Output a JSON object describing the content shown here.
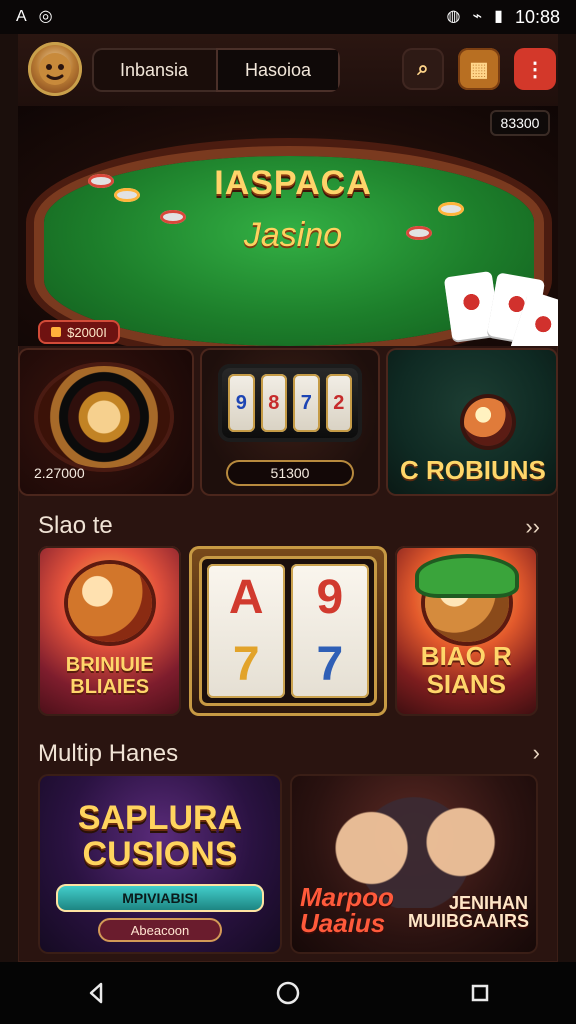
{
  "status_bar": {
    "left_icons": [
      "A",
      "◎"
    ],
    "time": "10:88"
  },
  "header": {
    "tabs": [
      {
        "label": "Inbansia",
        "active": false
      },
      {
        "label": "Hasoioa",
        "active": true
      }
    ],
    "buttons": {
      "search_icon": "search-icon",
      "grid_icon": "grid-icon",
      "menu_icon": "more-vert-icon"
    }
  },
  "hero": {
    "title": "IASPACA",
    "subtitle": "Jasino",
    "top_badge": "83300",
    "left_chip_value": "$2000I"
  },
  "featured": [
    {
      "id": "roulette",
      "amount": "2.27000"
    },
    {
      "id": "slots",
      "amount": "51300"
    },
    {
      "id": "poker",
      "title": "C ROBIUNS"
    }
  ],
  "sections": {
    "slots": {
      "title": "Slao te",
      "arrow": "››"
    },
    "multi": {
      "title": "Multip Hanes",
      "arrow": "›"
    }
  },
  "slots_games": [
    {
      "title": "BRINIUIE\nBLIAIES"
    },
    {
      "title": "A 9\n7 7"
    },
    {
      "title": "BIAO R\nSIANS"
    }
  ],
  "multi_games": [
    {
      "title": "SAPLURA\nCUSIONS",
      "ribbon": "MPIVIABISI",
      "button": "Abeacoon"
    },
    {
      "title": "Marpoo\nUaaius",
      "subtitle": "JENIHAN\nMUIIBGAAIRS"
    }
  ],
  "colors": {
    "accent_gold": "#ffd46a",
    "danger_red": "#d3382a",
    "table_green": "#1d7f2b"
  }
}
